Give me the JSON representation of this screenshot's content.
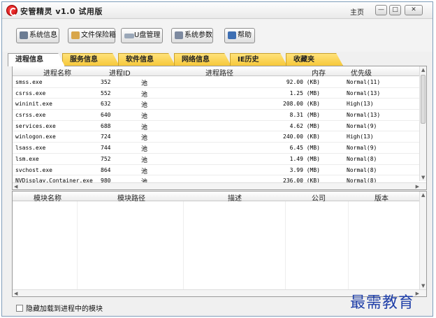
{
  "window": {
    "title": "安管精灵 v1.0 试用版",
    "home": "主页",
    "min": "—",
    "max": "□",
    "close": "✕"
  },
  "toolbar": {
    "system_info": "系统信息",
    "file_vault": "文件保险箱",
    "usb_manage": "U盘管理",
    "system_params": "系统参数",
    "help": "帮助"
  },
  "tabs": [
    "进程信息",
    "服务信息",
    "软件信息",
    "网络信息",
    "IE历史",
    "收藏夹"
  ],
  "process_table": {
    "headers": [
      "进程名称",
      "进程ID",
      "进程路径",
      "内存",
      "优先级"
    ],
    "rows": [
      {
        "name": "smss.exe",
        "pid": "352",
        "path": "池",
        "mem": "92.00 (KB)",
        "pri": "Normal(11)"
      },
      {
        "name": "csrss.exe",
        "pid": "552",
        "path": "池",
        "mem": "1.25 (MB)",
        "pri": "Normal(13)"
      },
      {
        "name": "wininit.exe",
        "pid": "632",
        "path": "池",
        "mem": "208.00 (KB)",
        "pri": "High(13)"
      },
      {
        "name": "csrss.exe",
        "pid": "640",
        "path": "池",
        "mem": "8.31 (MB)",
        "pri": "Normal(13)"
      },
      {
        "name": "services.exe",
        "pid": "688",
        "path": "池",
        "mem": "4.62 (MB)",
        "pri": "Normal(9)"
      },
      {
        "name": "winlogon.exe",
        "pid": "724",
        "path": "池",
        "mem": "240.00 (KB)",
        "pri": "High(13)"
      },
      {
        "name": "lsass.exe",
        "pid": "744",
        "path": "池",
        "mem": "6.45 (MB)",
        "pri": "Normal(9)"
      },
      {
        "name": "lsm.exe",
        "pid": "752",
        "path": "池",
        "mem": "1.49 (MB)",
        "pri": "Normal(8)"
      },
      {
        "name": "svchost.exe",
        "pid": "864",
        "path": "池",
        "mem": "3.99 (MB)",
        "pri": "Normal(8)"
      },
      {
        "name": "NVDisplay.Container.exe",
        "pid": "980",
        "path": "池",
        "mem": "236.00 (KB)",
        "pri": "Normal(8)"
      }
    ]
  },
  "module_table": {
    "headers": [
      "模块名称",
      "模块路径",
      "描述",
      "公司",
      "版本"
    ]
  },
  "footer": {
    "hide_modules_checkbox": "隐藏加载到进程中的模块"
  },
  "watermark": "最需教育"
}
